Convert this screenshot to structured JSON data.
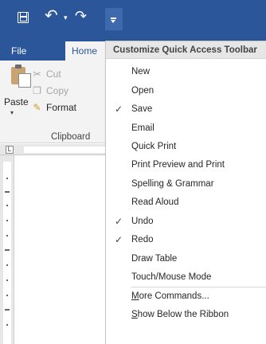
{
  "ribbon": {
    "tabs": [
      "File",
      "Home"
    ],
    "clipboard": {
      "paste": "Paste",
      "cut": "Cut",
      "copy": "Copy",
      "format": "Format",
      "group": "Clipboard"
    }
  },
  "menu": {
    "title": "Customize Quick Access Toolbar",
    "items": [
      {
        "label": "New",
        "checked": false
      },
      {
        "label": "Open",
        "checked": false
      },
      {
        "label": "Save",
        "checked": true
      },
      {
        "label": "Email",
        "checked": false
      },
      {
        "label": "Quick Print",
        "checked": false
      },
      {
        "label": "Print Preview and Print",
        "checked": false
      },
      {
        "label": "Spelling & Grammar",
        "checked": false
      },
      {
        "label": "Read Aloud",
        "checked": false
      },
      {
        "label": "Undo",
        "checked": true
      },
      {
        "label": "Redo",
        "checked": true
      },
      {
        "label": "Draw Table",
        "checked": false
      },
      {
        "label": "Touch/Mouse Mode",
        "checked": false
      }
    ],
    "more_commands_first": "M",
    "more_commands_rest": "ore Commands...",
    "show_below_first": "S",
    "show_below_rest": "how Below the Ribbon",
    "check_glyph": "✓"
  },
  "icons": {
    "qat": [
      "save-icon",
      "undo-icon",
      "redo-icon",
      "customize-dropdown-icon"
    ],
    "clipboard": [
      "paste-icon",
      "cut-icon",
      "copy-icon",
      "format-painter-icon"
    ]
  }
}
